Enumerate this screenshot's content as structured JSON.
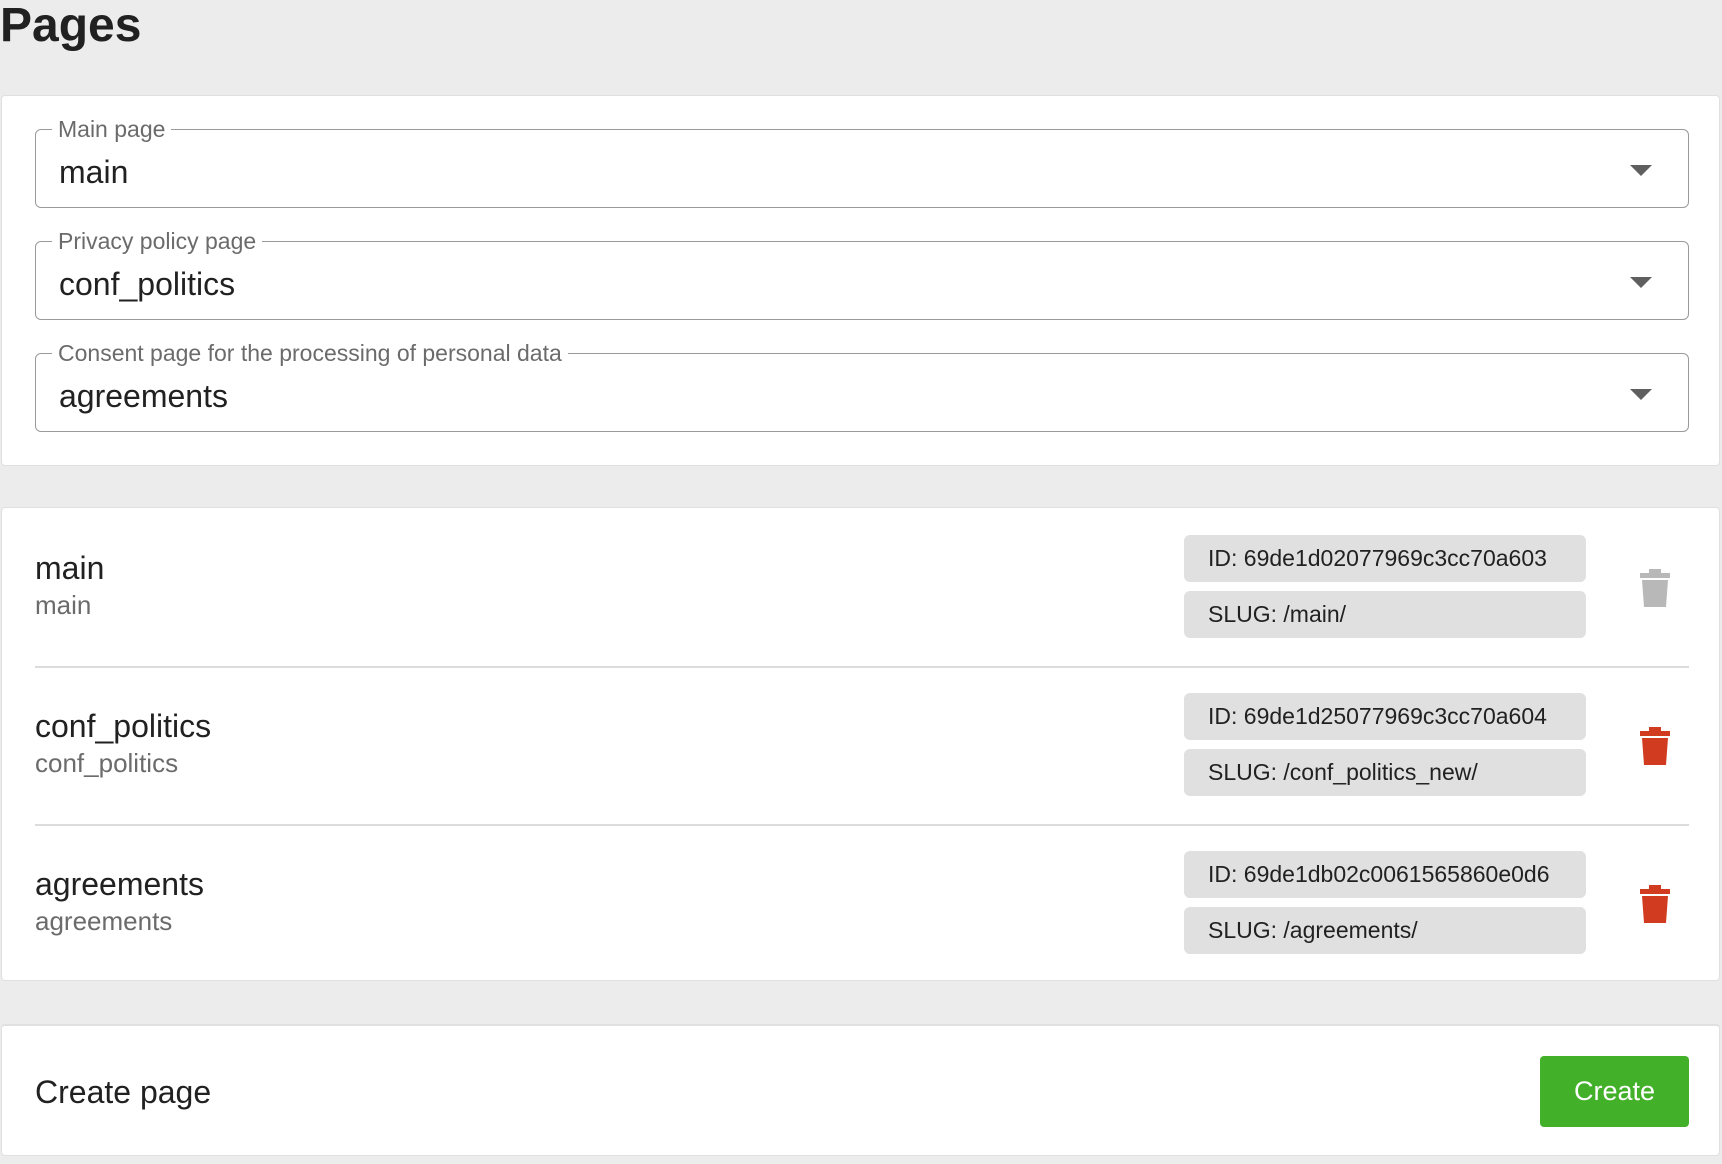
{
  "header": {
    "title": "Pages"
  },
  "settings": {
    "main_page": {
      "label": "Main page",
      "value": "main"
    },
    "privacy_page": {
      "label": "Privacy policy page",
      "value": "conf_politics"
    },
    "consent_page": {
      "label": "Consent page for the processing of personal data",
      "value": "agreements"
    }
  },
  "pages": [
    {
      "title": "main",
      "subtitle": "main",
      "id": "ID: 69de1d02077969c3cc70a603",
      "slug": "SLUG: /main/",
      "delete_enabled": false
    },
    {
      "title": "conf_politics",
      "subtitle": "conf_politics",
      "id": "ID: 69de1d25077969c3cc70a604",
      "slug": "SLUG: /conf_politics_new/",
      "delete_enabled": true
    },
    {
      "title": "agreements",
      "subtitle": "agreements",
      "id": "ID: 69de1db02c0061565860e0d6",
      "slug": "SLUG: /agreements/",
      "delete_enabled": true
    }
  ],
  "create": {
    "label": "Create page",
    "button": "Create"
  },
  "colors": {
    "delete_active": "#d13b20",
    "delete_disabled": "#b8b8b8",
    "create_button": "#43b02a"
  },
  "icons": {
    "delete": "trash-icon",
    "select": "caret-down-icon"
  }
}
